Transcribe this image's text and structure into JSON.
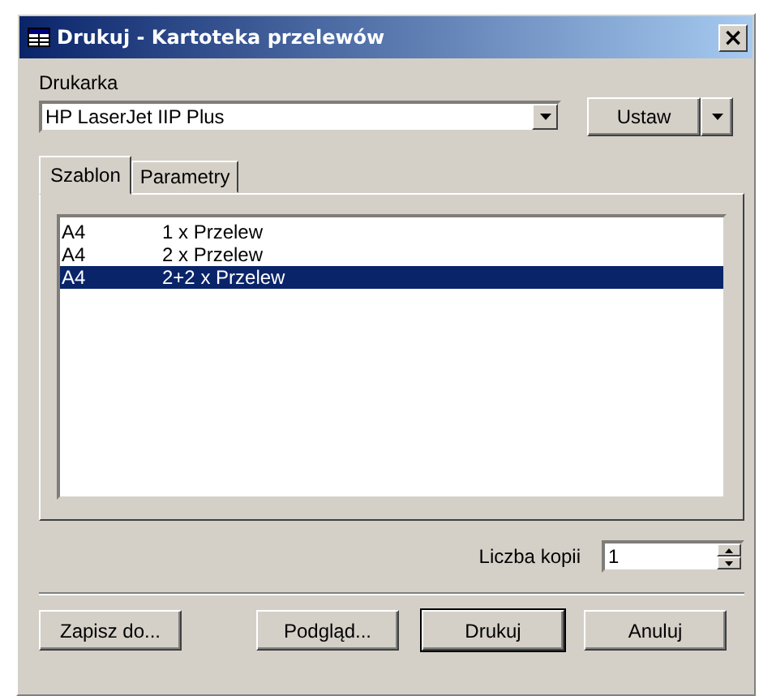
{
  "window": {
    "title": "Drukuj - Kartoteka przelewów",
    "close": "×"
  },
  "printer": {
    "label": "Drukarka",
    "value": "HP LaserJet IIP Plus",
    "setup_button": {
      "label": "Ustaw"
    }
  },
  "tabs": [
    {
      "label": "Szablon",
      "selected": true
    },
    {
      "label": "Parametry",
      "selected": false
    }
  ],
  "templates": [
    {
      "format": "A4",
      "name": "1 x Przelew",
      "selected": false
    },
    {
      "format": "A4",
      "name": "2 x Przelew",
      "selected": false
    },
    {
      "format": "A4",
      "name": "2+2 x Przelew",
      "selected": true
    }
  ],
  "copies": {
    "label": "Liczba kopii",
    "value": "1"
  },
  "buttons": [
    {
      "label": "Zapisz do...",
      "default": false
    },
    {
      "label": "Podgląd...",
      "default": false
    },
    {
      "label": "Drukuj",
      "default": true
    },
    {
      "label": "Anuluj",
      "default": false
    }
  ]
}
